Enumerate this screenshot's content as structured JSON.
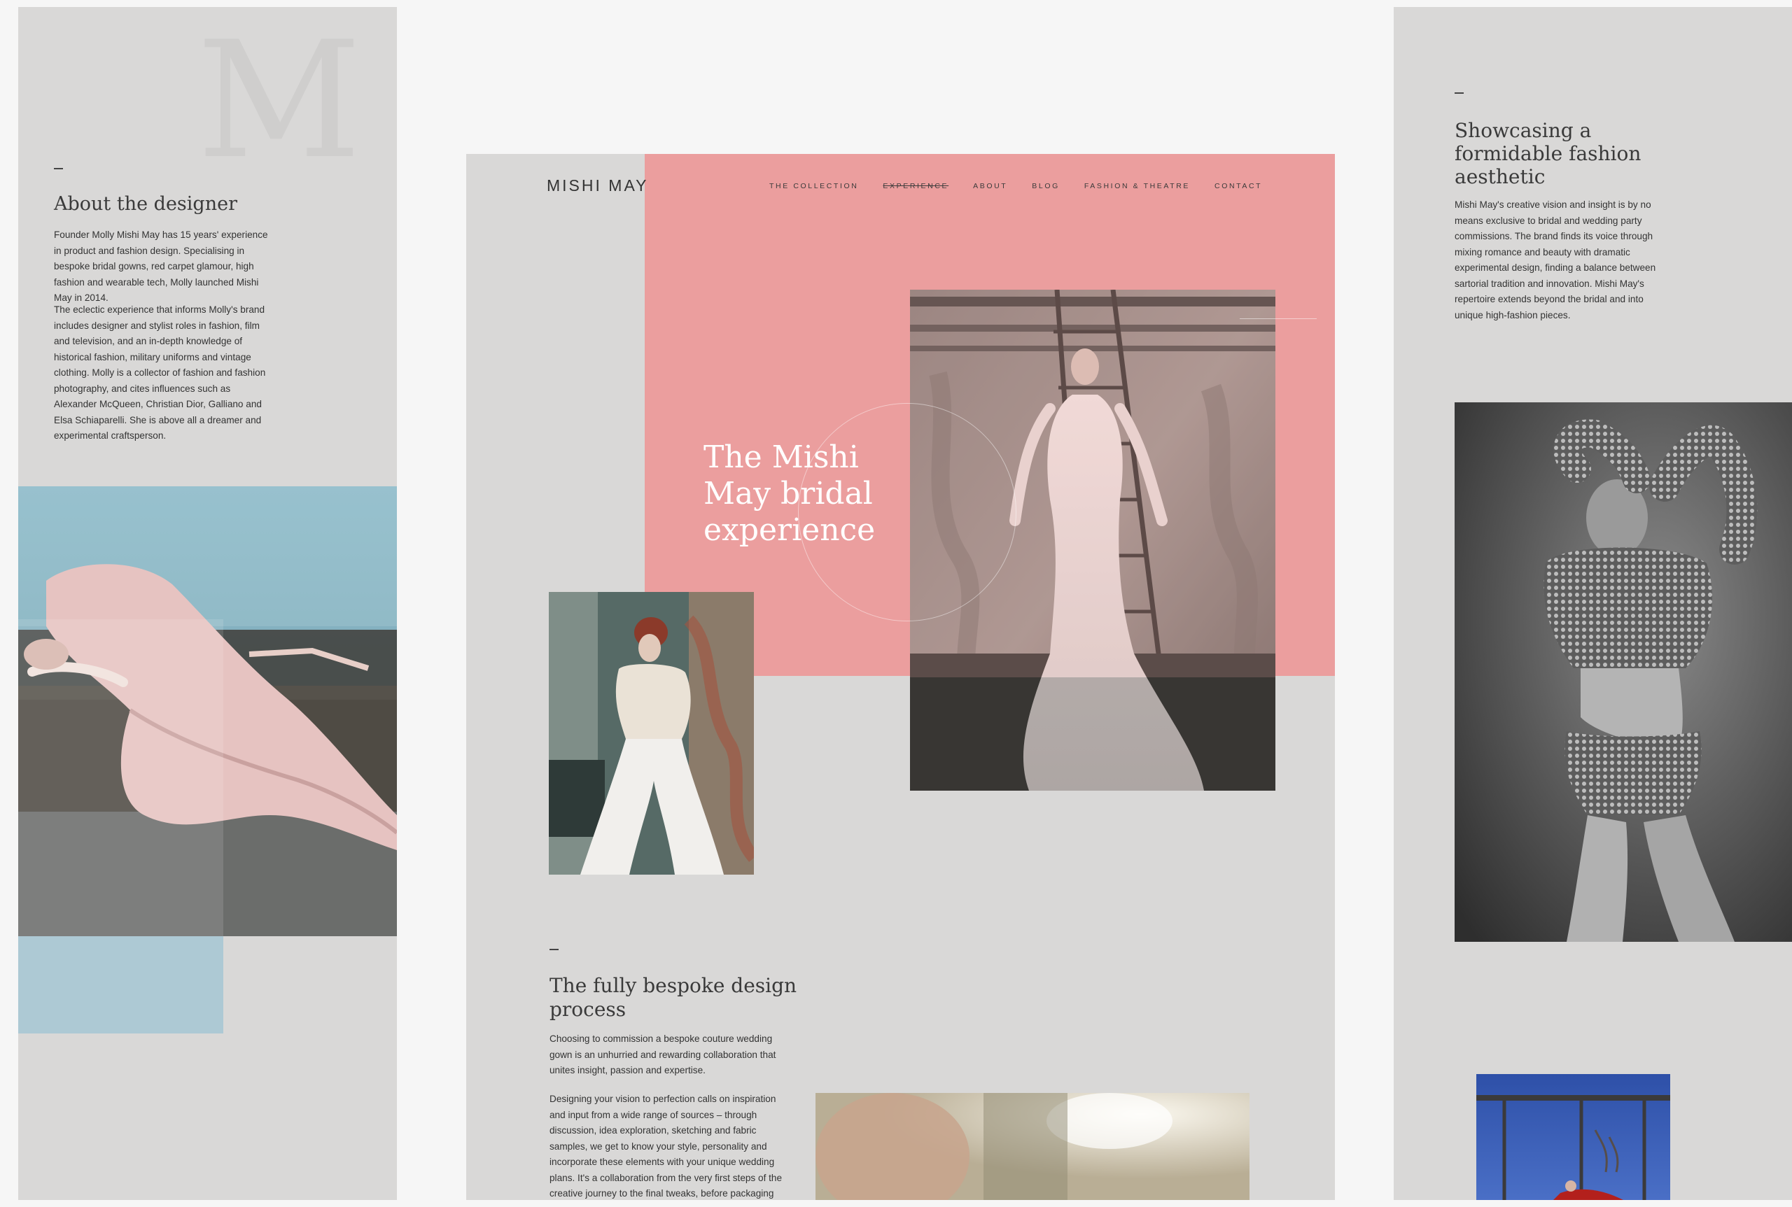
{
  "left": {
    "heading": "About the designer",
    "paragraph1": "Founder Molly Mishi May has 15 years' experience in product and fashion design. Specialising in bespoke bridal gowns, red carpet glamour, high fashion and wearable tech, Molly launched Mishi May in 2014.",
    "paragraph2": "The eclectic experience that informs Molly's brand includes designer and stylist roles in fashion, film and television, and an in-depth knowledge of historical fashion, military uniforms and vintage clothing. Molly is a collector of fashion and fashion photography, and cites influences such as Alexander McQueen, Christian Dior, Galliano and Elsa Schiaparelli. She is above all a dreamer and experimental craftsperson.",
    "decorative_letter": "M"
  },
  "center": {
    "logo": "MISHI MAY",
    "nav": [
      {
        "label": "THE COLLECTION",
        "active": false
      },
      {
        "label": "EXPERIENCE",
        "active": true
      },
      {
        "label": "ABOUT",
        "active": false
      },
      {
        "label": "BLOG",
        "active": false
      },
      {
        "label": "FASHION & THEATRE",
        "active": false
      },
      {
        "label": "CONTACT",
        "active": false
      }
    ],
    "hero_title": "The Mishi May bridal experience",
    "process_heading": "The fully bespoke design process",
    "process_p1": "Choosing to commission a bespoke couture wedding gown is an unhurried and rewarding collaboration that unites insight, passion and expertise.",
    "process_p2": "Designing your vision to perfection calls on inspiration and input from a wide range of sources – through discussion, idea exploration, sketching and fabric samples, we get to know your style, personality and incorporate these elements with your unique wedding plans. It's a collaboration from the very first steps of the creative journey to the final tweaks, before packaging your gown"
  },
  "right": {
    "heading": "Showcasing a formidable fashion aesthetic",
    "paragraph": "Mishi May's creative vision and insight is by no means exclusive to bridal and wedding party commissions. The brand finds its voice through mixing romance and beauty with dramatic experimental design, finding a balance between sartorial tradition and innovation. Mishi May's repertoire extends beyond the bridal and into unique high-fashion pieces."
  },
  "colors": {
    "panel": "#d9d8d7",
    "pink": "#eb9e9e",
    "blue_block": "#adc9d4",
    "background": "#f6f6f6"
  }
}
